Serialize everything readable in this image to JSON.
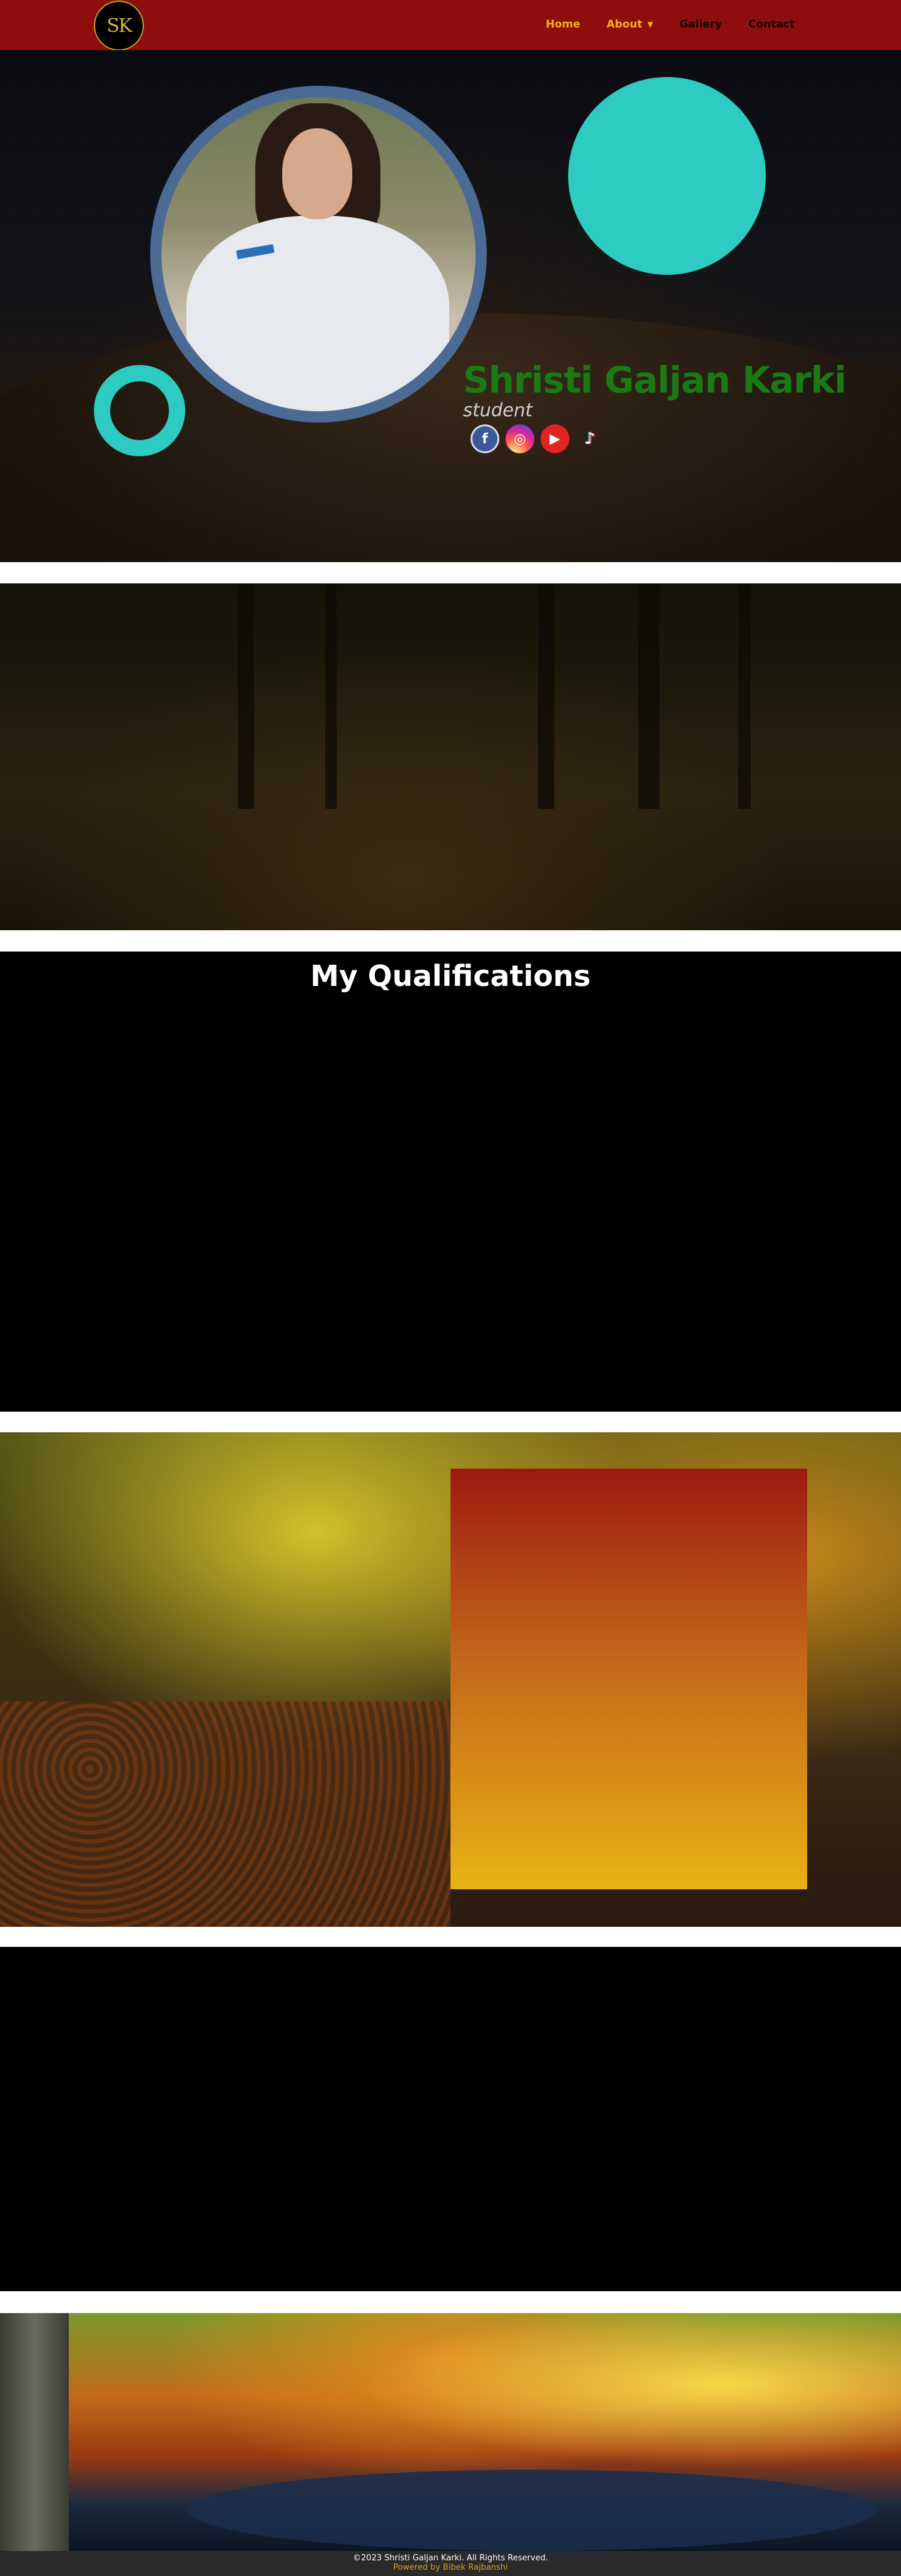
{
  "nav": {
    "logo_text": "SK",
    "items": [
      {
        "label": "Home"
      },
      {
        "label": "About",
        "caret": "▼"
      },
      {
        "label": "Gallery"
      },
      {
        "label": "Contact"
      }
    ]
  },
  "hero": {
    "name": "Shristi Galjan Karki",
    "role": "student",
    "socials": [
      {
        "icon": "facebook-icon",
        "glyph": "f"
      },
      {
        "icon": "instagram-icon",
        "glyph": "◎"
      },
      {
        "icon": "youtube-icon",
        "glyph": "▶"
      },
      {
        "icon": "tiktok-icon",
        "glyph": "♪"
      }
    ]
  },
  "qualifications": {
    "title": "My Qualifications"
  },
  "footer": {
    "copyright": "©2023  Shristi Galjan Karki. All Rights Reserved.",
    "powered": "Powered by Bibek Rajbanshi"
  },
  "colors": {
    "nav_bg": "#8e0e0e",
    "nav_active": "#f2b21b",
    "accent_cyan": "#2ecbc2",
    "name_green": "#1a7a14",
    "profile_ring": "#4b6a94"
  }
}
